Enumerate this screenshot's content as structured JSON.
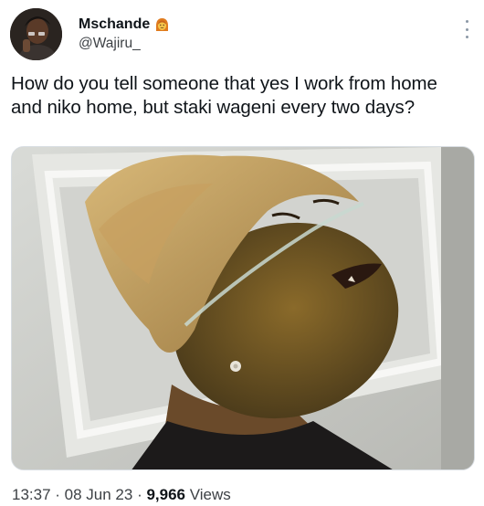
{
  "author": {
    "display_name": "Mschande",
    "handle": "@Wajiru_",
    "emoji_icon": "woman-emoji-icon"
  },
  "tweet": {
    "lines": [
      "How do you tell someone that yes I work from home",
      "and niko home, but staki wageni every two days?"
    ]
  },
  "meta": {
    "time": "13:37",
    "sep1": " · ",
    "date": "08 Jun 23",
    "sep2": " · ",
    "views_count": "9,966",
    "views_label": " Views"
  },
  "colors": {
    "text": "#0f1419",
    "secondary": "#3d4145",
    "border": "#d8dde2"
  }
}
